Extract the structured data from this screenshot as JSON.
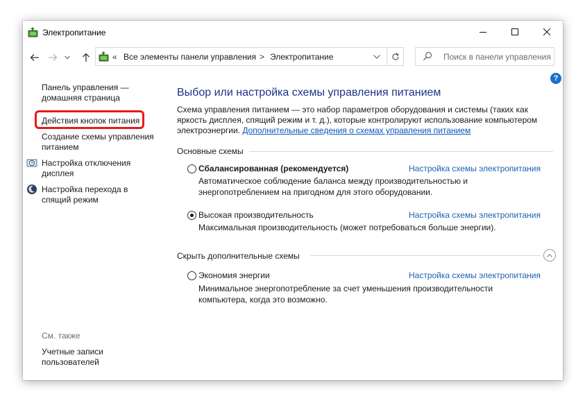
{
  "window": {
    "title": "Электропитание"
  },
  "nav": {
    "breadcrumb_root": "«",
    "breadcrumb_items": [
      "Все элементы панели управления",
      "Электропитание"
    ],
    "separator": ">",
    "search_placeholder": "Поиск в панели управления"
  },
  "help": {
    "label": "?"
  },
  "sidebar": {
    "items": [
      {
        "label": "Панель управления — домашняя страница"
      },
      {
        "label": "Действия кнопок питания"
      },
      {
        "label": "Создание схемы управления питанием"
      },
      {
        "label": "Настройка отключения дисплея"
      },
      {
        "label": "Настройка перехода в спящий режим"
      }
    ],
    "see_also_title": "См. также",
    "see_also_items": [
      {
        "label": "Учетные записи пользователей"
      }
    ]
  },
  "main": {
    "title": "Выбор или настройка схемы управления питанием",
    "description": "Схема управления питанием — это набор параметров оборудования и системы (таких как яркость дисплея, спящий режим и т. д.), которые контролируют использование компьютером электроэнергии.",
    "description_link": "Дополнительные сведения о схемах управления питанием",
    "group_main": "Основные схемы",
    "group_extra": "Скрыть дополнительные схемы",
    "plans": [
      {
        "name": "Сбалансированная (рекомендуется)",
        "desc": "Автоматическое соблюдение баланса между производительностью и энергопотреблением на пригодном для этого оборудовании.",
        "link": "Настройка схемы электропитания",
        "selected": false
      },
      {
        "name": "Высокая производительность",
        "desc": "Максимальная производительность (может потребоваться больше энергии).",
        "link": "Настройка схемы электропитания",
        "selected": true
      }
    ],
    "extra_plans": [
      {
        "name": "Экономия энергии",
        "desc": "Минимальное энергопотребление за счет уменьшения производительности компьютера, когда это возможно.",
        "link": "Настройка схемы электропитания",
        "selected": false
      }
    ]
  },
  "colors": {
    "title": "#1e3287",
    "link": "#1c5fb0",
    "highlight": "#e8191b",
    "help": "#1c6fc9"
  },
  "icons": [
    "power-options-icon",
    "back-arrow-icon",
    "forward-arrow-icon",
    "recent-dropdown-icon",
    "up-arrow-icon",
    "chevron-down-icon",
    "refresh-icon",
    "search-icon",
    "help-icon",
    "display-clock-icon",
    "moon-icon",
    "collapse-chevron-icon",
    "minimize-icon",
    "maximize-icon",
    "close-icon"
  ]
}
